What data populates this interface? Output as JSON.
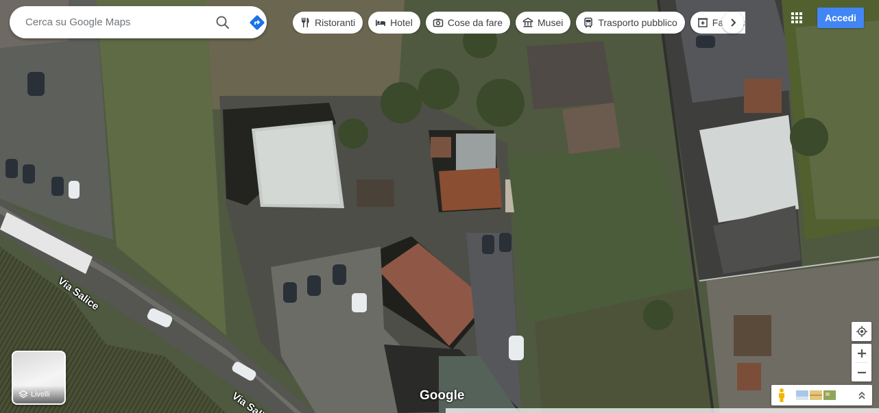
{
  "search": {
    "placeholder": "Cerca su Google Maps"
  },
  "chips": [
    {
      "label": "Ristoranti",
      "icon": "fork-knife-icon"
    },
    {
      "label": "Hotel",
      "icon": "bed-icon"
    },
    {
      "label": "Cose da fare",
      "icon": "camera-icon"
    },
    {
      "label": "Musei",
      "icon": "museum-icon"
    },
    {
      "label": "Trasporto pubblico",
      "icon": "bus-icon"
    },
    {
      "label": "Farmacie",
      "icon": "pharmacy-icon"
    }
  ],
  "header": {
    "signin_label": "Accedi"
  },
  "map": {
    "roads": [
      {
        "label": "Via Salice"
      },
      {
        "label": "Via Salice"
      }
    ],
    "logo": "Google"
  },
  "layers": {
    "label": "Livelli"
  },
  "colors": {
    "signin_bg": "#4285f4",
    "directions_icon": "#1a73e8",
    "pegman": "#f5b400"
  }
}
